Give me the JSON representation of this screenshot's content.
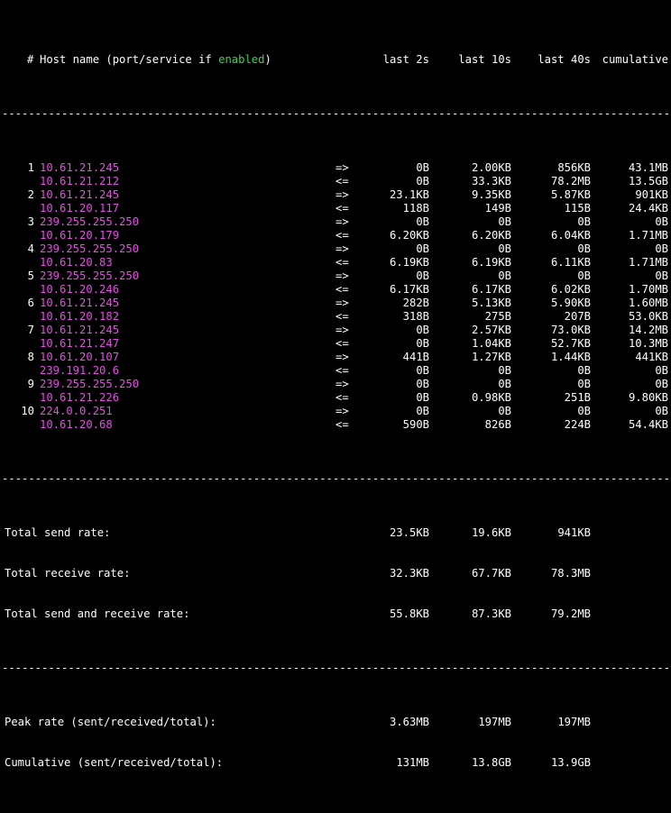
{
  "header": {
    "hash": "#",
    "title_prefix": "Host name (port/service if ",
    "title_enabled": "enabled",
    "title_suffix": ")",
    "col_2s": "last 2s",
    "col_10s": "last 10s",
    "col_40s": "last 40s",
    "col_cum": "cumulative"
  },
  "separator": "--------------------------------------------------------------------------------------------------------------------------------------------",
  "colors": {
    "host": "#e64de6",
    "enabled": "#3fd24a",
    "text": "#ffffff",
    "background": "#000000"
  },
  "connections": [
    {
      "idx": "1",
      "src": "10.61.21.245",
      "dst": "10.61.21.212",
      "out": [
        "0B",
        "2.00KB",
        "856KB",
        "43.1MB"
      ],
      "in": [
        "0B",
        "33.3KB",
        "78.2MB",
        "13.5GB"
      ]
    },
    {
      "idx": "2",
      "src": "10.61.21.245",
      "dst": "10.61.20.117",
      "out": [
        "23.1KB",
        "9.35KB",
        "5.87KB",
        "901KB"
      ],
      "in": [
        "118B",
        "149B",
        "115B",
        "24.4KB"
      ]
    },
    {
      "idx": "3",
      "src": "239.255.255.250",
      "dst": "10.61.20.179",
      "out": [
        "0B",
        "0B",
        "0B",
        "0B"
      ],
      "in": [
        "6.20KB",
        "6.20KB",
        "6.04KB",
        "1.71MB"
      ]
    },
    {
      "idx": "4",
      "src": "239.255.255.250",
      "dst": "10.61.20.83",
      "out": [
        "0B",
        "0B",
        "0B",
        "0B"
      ],
      "in": [
        "6.19KB",
        "6.19KB",
        "6.11KB",
        "1.71MB"
      ]
    },
    {
      "idx": "5",
      "src": "239.255.255.250",
      "dst": "10.61.20.246",
      "out": [
        "0B",
        "0B",
        "0B",
        "0B"
      ],
      "in": [
        "6.17KB",
        "6.17KB",
        "6.02KB",
        "1.70MB"
      ]
    },
    {
      "idx": "6",
      "src": "10.61.21.245",
      "dst": "10.61.20.182",
      "out": [
        "282B",
        "5.13KB",
        "5.90KB",
        "1.60MB"
      ],
      "in": [
        "318B",
        "275B",
        "207B",
        "53.0KB"
      ]
    },
    {
      "idx": "7",
      "src": "10.61.21.245",
      "dst": "10.61.21.247",
      "out": [
        "0B",
        "2.57KB",
        "73.0KB",
        "14.2MB"
      ],
      "in": [
        "0B",
        "1.04KB",
        "52.7KB",
        "10.3MB"
      ]
    },
    {
      "idx": "8",
      "src": "10.61.20.107",
      "dst": "239.191.20.6",
      "out": [
        "441B",
        "1.27KB",
        "1.44KB",
        "441KB"
      ],
      "in": [
        "0B",
        "0B",
        "0B",
        "0B"
      ]
    },
    {
      "idx": "9",
      "src": "239.255.255.250",
      "dst": "10.61.21.226",
      "out": [
        "0B",
        "0B",
        "0B",
        "0B"
      ],
      "in": [
        "0B",
        "0.98KB",
        "251B",
        "9.80KB"
      ]
    },
    {
      "idx": "10",
      "src": "224.0.0.251",
      "dst": "10.61.20.68",
      "out": [
        "0B",
        "0B",
        "0B",
        "0B"
      ],
      "in": [
        "590B",
        "826B",
        "224B",
        "54.4KB"
      ]
    }
  ],
  "arrows": {
    "out": "=>",
    "in": "<="
  },
  "totals": {
    "send": {
      "label": "Total send rate:",
      "v2s": "23.5KB",
      "v10s": "19.6KB",
      "v40s": "941KB"
    },
    "receive": {
      "label": "Total receive rate:",
      "v2s": "32.3KB",
      "v10s": "67.7KB",
      "v40s": "78.3MB"
    },
    "both": {
      "label": "Total send and receive rate:",
      "v2s": "55.8KB",
      "v10s": "87.3KB",
      "v40s": "79.2MB"
    }
  },
  "summary": {
    "peak": {
      "label": "Peak rate (sent/received/total):",
      "sent": "3.63MB",
      "received": "197MB",
      "total": "197MB"
    },
    "cumulative": {
      "label": "Cumulative (sent/received/total):",
      "sent": "131MB",
      "received": "13.8GB",
      "total": "13.9GB"
    }
  }
}
